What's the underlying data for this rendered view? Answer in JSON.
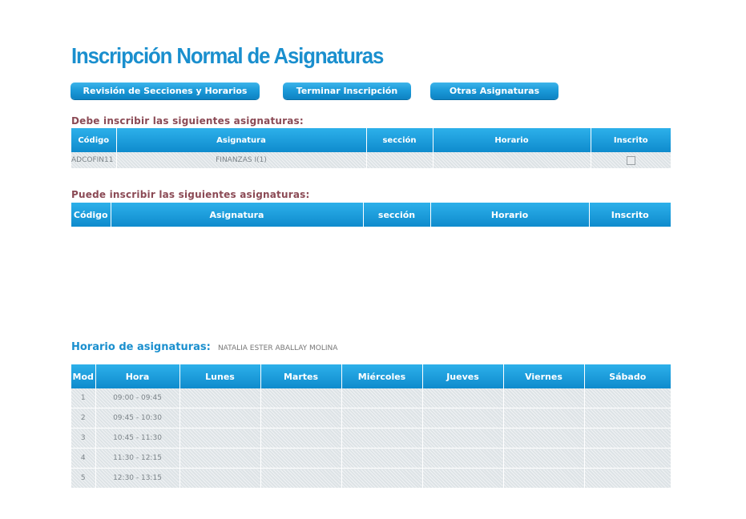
{
  "page": {
    "title": "Inscripción Normal de Asignaturas"
  },
  "buttons": {
    "revision": "Revisión de Secciones y Horarios",
    "terminar": "Terminar Inscripción",
    "otras": "Otras Asignaturas"
  },
  "debe": {
    "label": "Debe inscribir las siguientes asignaturas:",
    "headers": [
      "Código",
      "Asignatura",
      "sección",
      "Horario",
      "Inscrito"
    ],
    "rows": [
      {
        "codigo": "ADCOFIN11",
        "asignatura": "FINANZAS I(1)",
        "seccion": "",
        "horario": "",
        "inscrito": false
      }
    ]
  },
  "puede": {
    "label": "Puede inscribir las siguientes asignaturas:",
    "headers": [
      "Código",
      "Asignatura",
      "sección",
      "Horario",
      "Inscrito"
    ]
  },
  "horario": {
    "label": "Horario de asignaturas:",
    "student": "NATALIA ESTER ABALLAY MOLINA",
    "headers": [
      "Mod",
      "Hora",
      "Lunes",
      "Martes",
      "Miércoles",
      "Jueves",
      "Viernes",
      "Sábado"
    ],
    "rows": [
      {
        "mod": "1",
        "hora": "09:00 - 09:45"
      },
      {
        "mod": "2",
        "hora": "09:45 - 10:30"
      },
      {
        "mod": "3",
        "hora": "10:45 - 11:30"
      },
      {
        "mod": "4",
        "hora": "11:30 - 12:15"
      },
      {
        "mod": "5",
        "hora": "12:30 - 13:15"
      }
    ]
  }
}
